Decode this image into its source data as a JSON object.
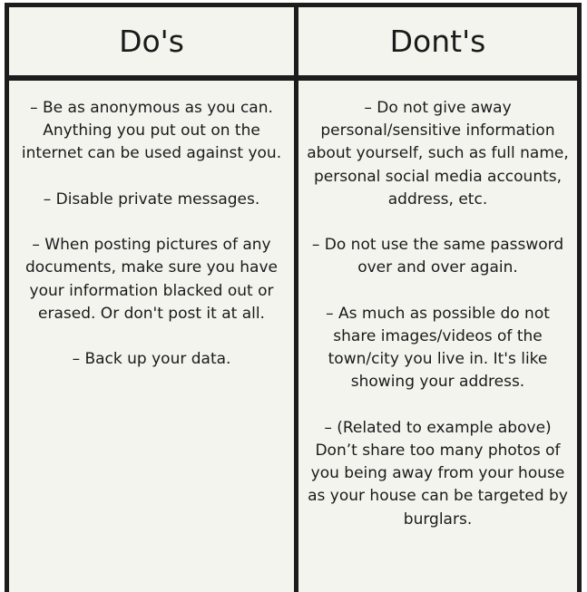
{
  "columns": {
    "dos": {
      "header": "Do's",
      "items": [
        "– Be as anonymous as you can. Anything you put out on the internet can be used against you.",
        "– Disable private messages.",
        "– When posting pictures of any documents, make sure you have your information blacked out or erased. Or don't post it at all.",
        "– Back up your data."
      ]
    },
    "donts": {
      "header": "Dont's",
      "items": [
        "– Do not give away personal/sensitive information about yourself, such as full name, personal social media accounts, address, etc.",
        "– Do not use the same password over and over again.",
        "– As much as possible do not share images/videos of the town/city you live in. It's like showing your address.",
        "– (Related to example above) Don’t share too many photos of you being away from your house as your house can be targeted by burglars."
      ]
    }
  }
}
